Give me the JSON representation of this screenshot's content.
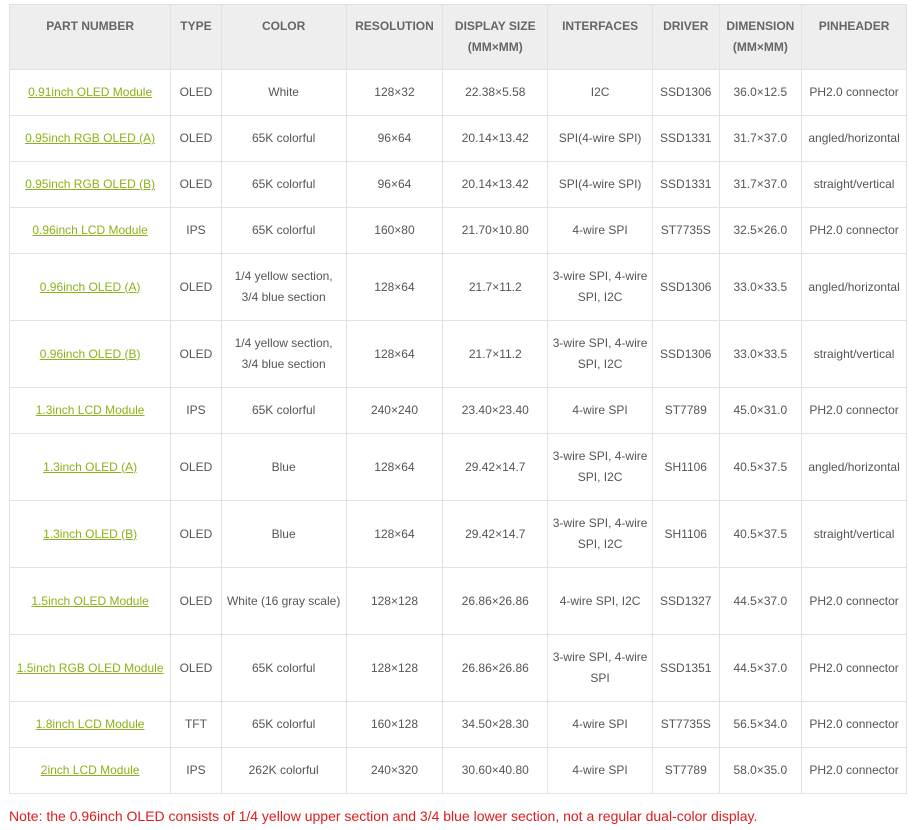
{
  "table": {
    "headers": [
      {
        "label": "PART NUMBER",
        "sub": ""
      },
      {
        "label": "TYPE",
        "sub": ""
      },
      {
        "label": "COLOR",
        "sub": ""
      },
      {
        "label": "RESOLUTION",
        "sub": ""
      },
      {
        "label": "DISPLAY SIZE",
        "sub": "(MM×MM)"
      },
      {
        "label": "INTERFACES",
        "sub": ""
      },
      {
        "label": "DRIVER",
        "sub": ""
      },
      {
        "label": "DIMENSION",
        "sub": "(MM×MM)"
      },
      {
        "label": "PINHEADER",
        "sub": ""
      }
    ],
    "rows": [
      {
        "part": "0.91inch OLED Module",
        "type": "OLED",
        "color": "White",
        "resolution": "128×32",
        "display_size": "22.38×5.58",
        "interfaces": "I2C",
        "driver": "SSD1306",
        "dimension": "36.0×12.5",
        "pinheader": "PH2.0 connector"
      },
      {
        "part": "0.95inch RGB OLED (A)",
        "type": "OLED",
        "color": "65K colorful",
        "resolution": "96×64",
        "display_size": "20.14×13.42",
        "interfaces": "SPI(4-wire SPI)",
        "driver": "SSD1331",
        "dimension": "31.7×37.0",
        "pinheader": "angled/horizontal"
      },
      {
        "part": "0.95inch RGB OLED (B)",
        "type": "OLED",
        "color": "65K colorful",
        "resolution": "96×64",
        "display_size": "20.14×13.42",
        "interfaces": "SPI(4-wire SPI)",
        "driver": "SSD1331",
        "dimension": "31.7×37.0",
        "pinheader": "straight/vertical"
      },
      {
        "part": "0.96inch LCD Module",
        "type": "IPS",
        "color": "65K colorful",
        "resolution": "160×80",
        "display_size": "21.70×10.80",
        "interfaces": "4-wire SPI",
        "driver": "ST7735S",
        "dimension": "32.5×26.0",
        "pinheader": "PH2.0 connector"
      },
      {
        "part": "0.96inch OLED (A)",
        "type": "OLED",
        "color": "1/4 yellow section, 3/4 blue section",
        "resolution": "128×64",
        "display_size": "21.7×11.2",
        "interfaces": "3-wire SPI, 4-wire SPI, I2C",
        "driver": "SSD1306",
        "dimension": "33.0×33.5",
        "pinheader": "angled/horizontal"
      },
      {
        "part": "0.96inch OLED (B)",
        "type": "OLED",
        "color": "1/4 yellow section, 3/4 blue section",
        "resolution": "128×64",
        "display_size": "21.7×11.2",
        "interfaces": "3-wire SPI, 4-wire SPI, I2C",
        "driver": "SSD1306",
        "dimension": "33.0×33.5",
        "pinheader": "straight/vertical"
      },
      {
        "part": "1.3inch LCD Module",
        "type": "IPS",
        "color": "65K colorful",
        "resolution": "240×240",
        "display_size": "23.40×23.40",
        "interfaces": "4-wire SPI",
        "driver": "ST7789",
        "dimension": "45.0×31.0",
        "pinheader": "PH2.0 connector"
      },
      {
        "part": "1.3inch OLED (A)",
        "type": "OLED",
        "color": "Blue",
        "resolution": "128×64",
        "display_size": "29.42×14.7",
        "interfaces": "3-wire SPI, 4-wire SPI, I2C",
        "driver": "SH1106",
        "dimension": "40.5×37.5",
        "pinheader": "angled/horizontal"
      },
      {
        "part": "1.3inch OLED (B)",
        "type": "OLED",
        "color": "Blue",
        "resolution": "128×64",
        "display_size": "29.42×14.7",
        "interfaces": "3-wire SPI, 4-wire SPI, I2C",
        "driver": "SH1106",
        "dimension": "40.5×37.5",
        "pinheader": "straight/vertical"
      },
      {
        "part": "1.5inch OLED Module",
        "type": "OLED",
        "color": "White (16 gray scale)",
        "resolution": "128×128",
        "display_size": "26.86×26.86",
        "interfaces": "4-wire SPI, I2C",
        "driver": "SSD1327",
        "dimension": "44.5×37.0",
        "pinheader": "PH2.0 connector"
      },
      {
        "part": "1.5inch RGB OLED Module",
        "type": "OLED",
        "color": "65K colorful",
        "resolution": "128×128",
        "display_size": "26.86×26.86",
        "interfaces": "3-wire SPI, 4-wire SPI",
        "driver": "SSD1351",
        "dimension": "44.5×37.0",
        "pinheader": "PH2.0 connector"
      },
      {
        "part": "1.8inch LCD Module",
        "type": "TFT",
        "color": "65K colorful",
        "resolution": "160×128",
        "display_size": "34.50×28.30",
        "interfaces": "4-wire SPI",
        "driver": "ST7735S",
        "dimension": "56.5×34.0",
        "pinheader": "PH2.0 connector"
      },
      {
        "part": "2inch LCD Module",
        "type": "IPS",
        "color": "262K colorful",
        "resolution": "240×320",
        "display_size": "30.60×40.80",
        "interfaces": "4-wire SPI",
        "driver": "ST7789",
        "dimension": "58.0×35.0",
        "pinheader": "PH2.0 connector"
      }
    ]
  },
  "note": "Note: the 0.96inch OLED consists of 1/4 yellow upper section and 3/4 blue lower section, not a regular dual-color display.",
  "colors": {
    "link": "#8ab318",
    "header_bg": "#eeeeee",
    "note": "#e01b1b",
    "border": "#e2e2e2"
  }
}
